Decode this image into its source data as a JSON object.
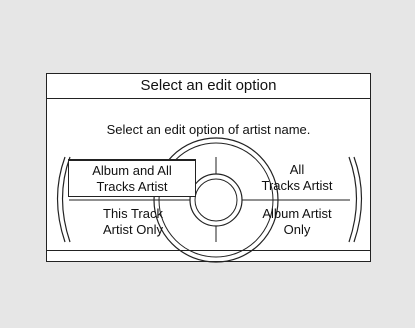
{
  "dialog": {
    "title": "Select an edit option",
    "prompt": "Select an edit option of artist name."
  },
  "options": {
    "album_and_all_tracks_artist": {
      "line1": "Album and All",
      "line2": "Tracks Artist",
      "selected": true
    },
    "all_tracks_artist": {
      "line1": "All",
      "line2": "Tracks Artist",
      "selected": false
    },
    "this_track_artist_only": {
      "line1": "This Track",
      "line2": "Artist Only",
      "selected": false
    },
    "album_artist_only": {
      "line1": "Album Artist",
      "line2": "Only",
      "selected": false
    }
  },
  "colors": {
    "background": "#e6e6e6",
    "screen": "#ffffff",
    "line": "#222222"
  },
  "icons": {
    "disc": "disc-graphic"
  }
}
